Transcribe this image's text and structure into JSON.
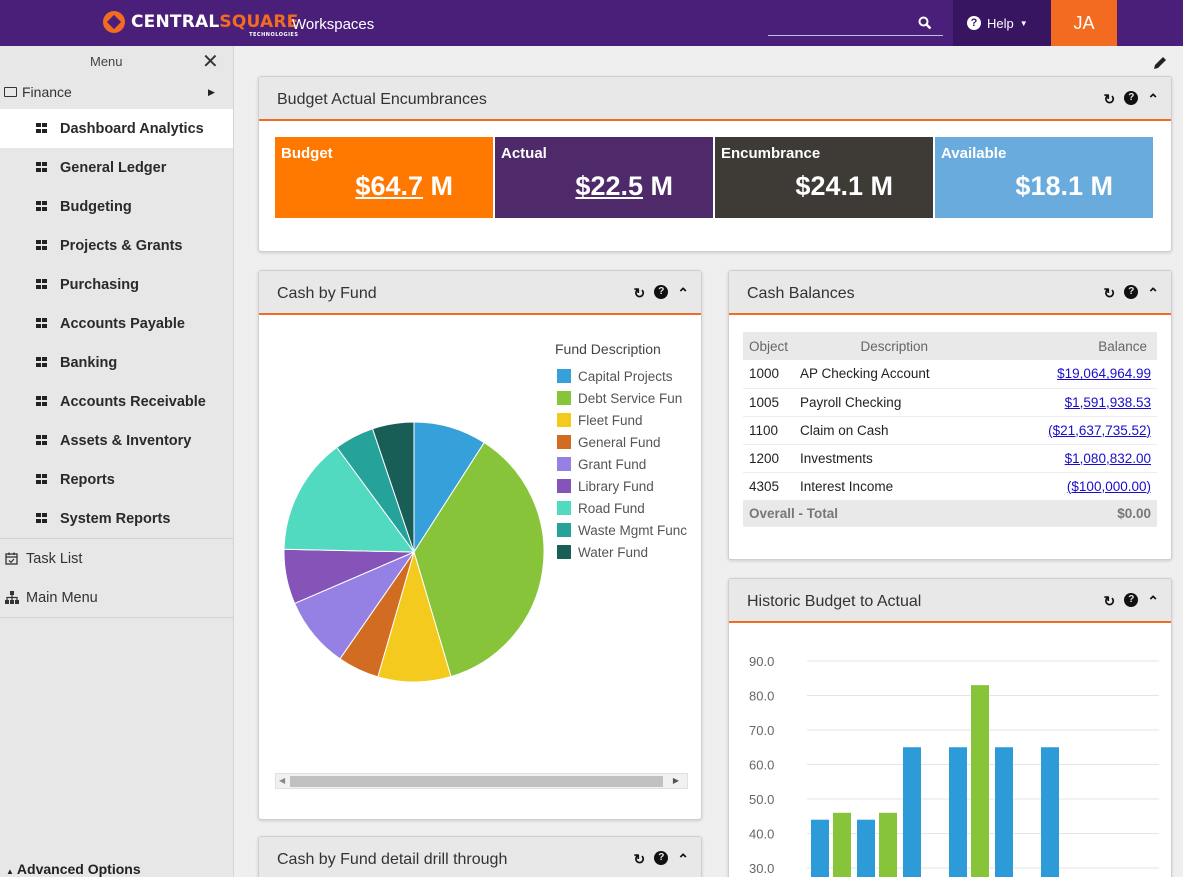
{
  "header": {
    "brand_main": "CENTRAL",
    "brand_accent": "SQUARE",
    "brand_sub": "TECHNOLOGIES",
    "workspaces": "Workspaces",
    "help_label": "Help",
    "user_initials": "JA"
  },
  "sidebar": {
    "menu_label": "Menu",
    "close_glyph": "✕",
    "finance_label": "Finance",
    "items": [
      {
        "label": "Dashboard Analytics",
        "active": true
      },
      {
        "label": "General Ledger"
      },
      {
        "label": "Budgeting"
      },
      {
        "label": "Projects & Grants"
      },
      {
        "label": "Purchasing"
      },
      {
        "label": "Accounts Payable"
      },
      {
        "label": "Banking"
      },
      {
        "label": "Accounts Receivable"
      },
      {
        "label": "Assets & Inventory"
      },
      {
        "label": "Reports"
      },
      {
        "label": "System Reports"
      }
    ],
    "task_list": "Task List",
    "main_menu": "Main Menu",
    "advanced": "Advanced Options"
  },
  "panels": {
    "encumbrances": {
      "title": "Budget Actual Encumbrances",
      "kpis": [
        {
          "label": "Budget",
          "amount": "$64.7",
          "unit": " M",
          "color": "#ff7900",
          "linked": true
        },
        {
          "label": "Actual",
          "amount": "$22.5",
          "unit": " M",
          "color": "#4e2a6b",
          "linked": true
        },
        {
          "label": "Encumbrance",
          "amount": "$24.1",
          "unit": " M",
          "color": "#3e3a36",
          "linked": false
        },
        {
          "label": "Available",
          "amount": "$18.1",
          "unit": " M",
          "color": "#6aabde",
          "linked": false
        }
      ]
    },
    "cash_by_fund": {
      "title": "Cash by Fund",
      "legend_title": "Fund Description"
    },
    "cash_balances": {
      "title": "Cash Balances",
      "columns": [
        "Object",
        "Description",
        "Balance"
      ],
      "rows": [
        {
          "object": "1000",
          "description": "AP Checking Account",
          "balance": "$19,064,964.99"
        },
        {
          "object": "1005",
          "description": "Payroll Checking",
          "balance": "$1,591,938.53"
        },
        {
          "object": "1100",
          "description": "Claim on Cash",
          "balance": "($21,637,735.52)"
        },
        {
          "object": "1200",
          "description": "Investments",
          "balance": "$1,080,832.00"
        },
        {
          "object": "4305",
          "description": "Interest Income",
          "balance": "($100,000.00)"
        }
      ],
      "total_label": "Overall - Total",
      "total_value": "$0.00"
    },
    "historic": {
      "title": "Historic Budget to Actual"
    },
    "drill": {
      "title": "Cash by Fund detail drill through"
    }
  },
  "chart_data": [
    {
      "type": "pie",
      "legend_title": "Fund Description",
      "legend_position": "right",
      "categories": [
        "Capital Projects",
        "Debt Service Fund",
        "Fleet Fund",
        "General Fund",
        "Grant Fund",
        "Library Fund",
        "Road Fund",
        "Waste Mgmt Fund",
        "Water Fund"
      ],
      "legend_labels": [
        "Capital Projects",
        "Debt Service Fun",
        "Fleet Fund",
        "General Fund",
        "Grant Fund",
        "Library Fund",
        "Road Fund",
        "Waste Mgmt Func",
        "Water Fund"
      ],
      "values": [
        8.8,
        35.2,
        8.8,
        5.0,
        8.6,
        6.6,
        14.1,
        4.8,
        5.0
      ],
      "colors": [
        "#35a0d9",
        "#88c43a",
        "#f4ca1f",
        "#d26c22",
        "#9581e3",
        "#8653b8",
        "#52dac0",
        "#25a39a",
        "#195e56"
      ]
    },
    {
      "type": "bar",
      "y_tick_labels": [
        "90.0",
        "80.0",
        "70.0",
        "60.0",
        "50.0",
        "40.0",
        "30.0"
      ],
      "ylim": [
        30,
        90
      ],
      "grid": true,
      "series": [
        {
          "values": [
            44,
            44,
            65,
            65,
            65,
            65
          ],
          "color": "#2d9bd8"
        },
        {
          "values": [
            46,
            46,
            null,
            83,
            null,
            null
          ],
          "color": "#88c43a"
        }
      ]
    }
  ]
}
